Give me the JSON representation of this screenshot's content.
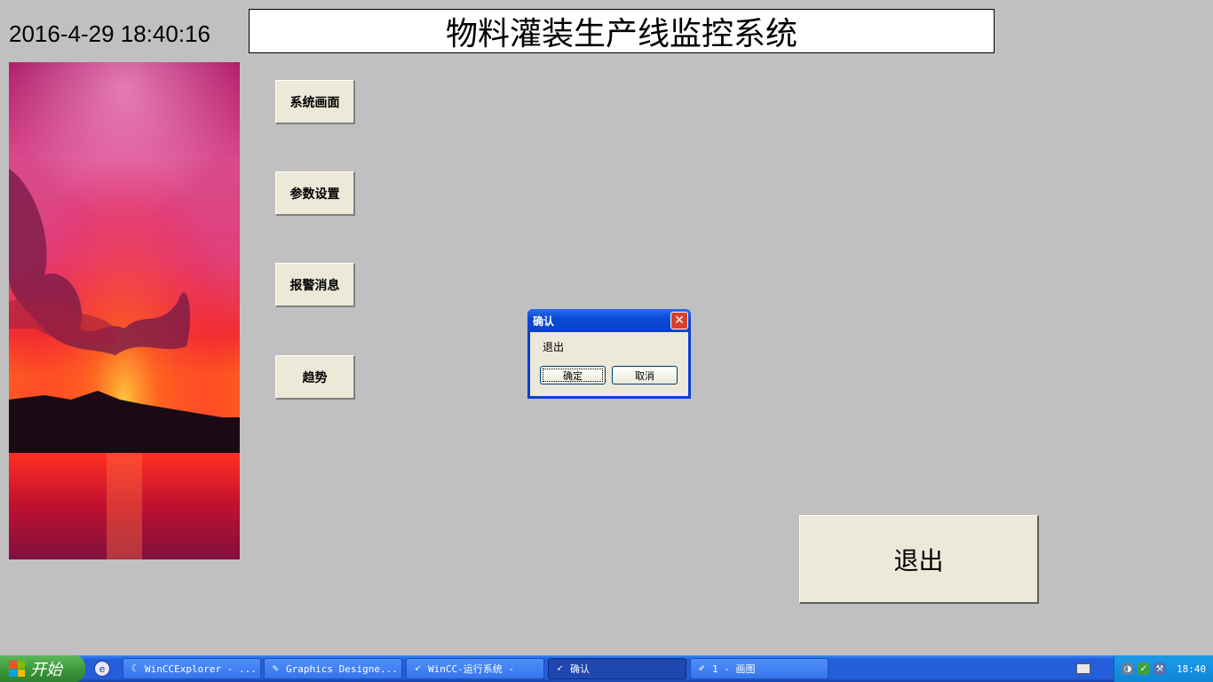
{
  "header": {
    "datetime": "2016-4-29 18:40:16",
    "title": "物料灌装生产线监控系统"
  },
  "nav": {
    "system_screen": "系统画面",
    "parameter_settings": "参数设置",
    "alarm_messages": "报警消息",
    "trend": "趋势"
  },
  "exit_button": "退出",
  "dialog": {
    "title": "确认",
    "message": "退出",
    "ok": "确定",
    "cancel": "取消",
    "close_symbol": "✕"
  },
  "taskbar": {
    "start_label": "开始",
    "tasks": [
      {
        "label": "WinCCExplorer - ...",
        "icon": "wincc-explorer-icon"
      },
      {
        "label": "Graphics Designe...",
        "icon": "graphics-designer-icon"
      },
      {
        "label": "WinCC-运行系统 -",
        "icon": "wincc-runtime-icon"
      },
      {
        "label": "确认",
        "icon": "wincc-runtime-icon",
        "active": true
      },
      {
        "label": "1 - 画图",
        "icon": "paint-icon"
      }
    ],
    "clock": "18:40"
  },
  "colors": {
    "background": "#c0c0c0",
    "button_face": "#ece9d8",
    "taskbar": "#245edb",
    "dialog_frame": "#0a3fd0"
  }
}
